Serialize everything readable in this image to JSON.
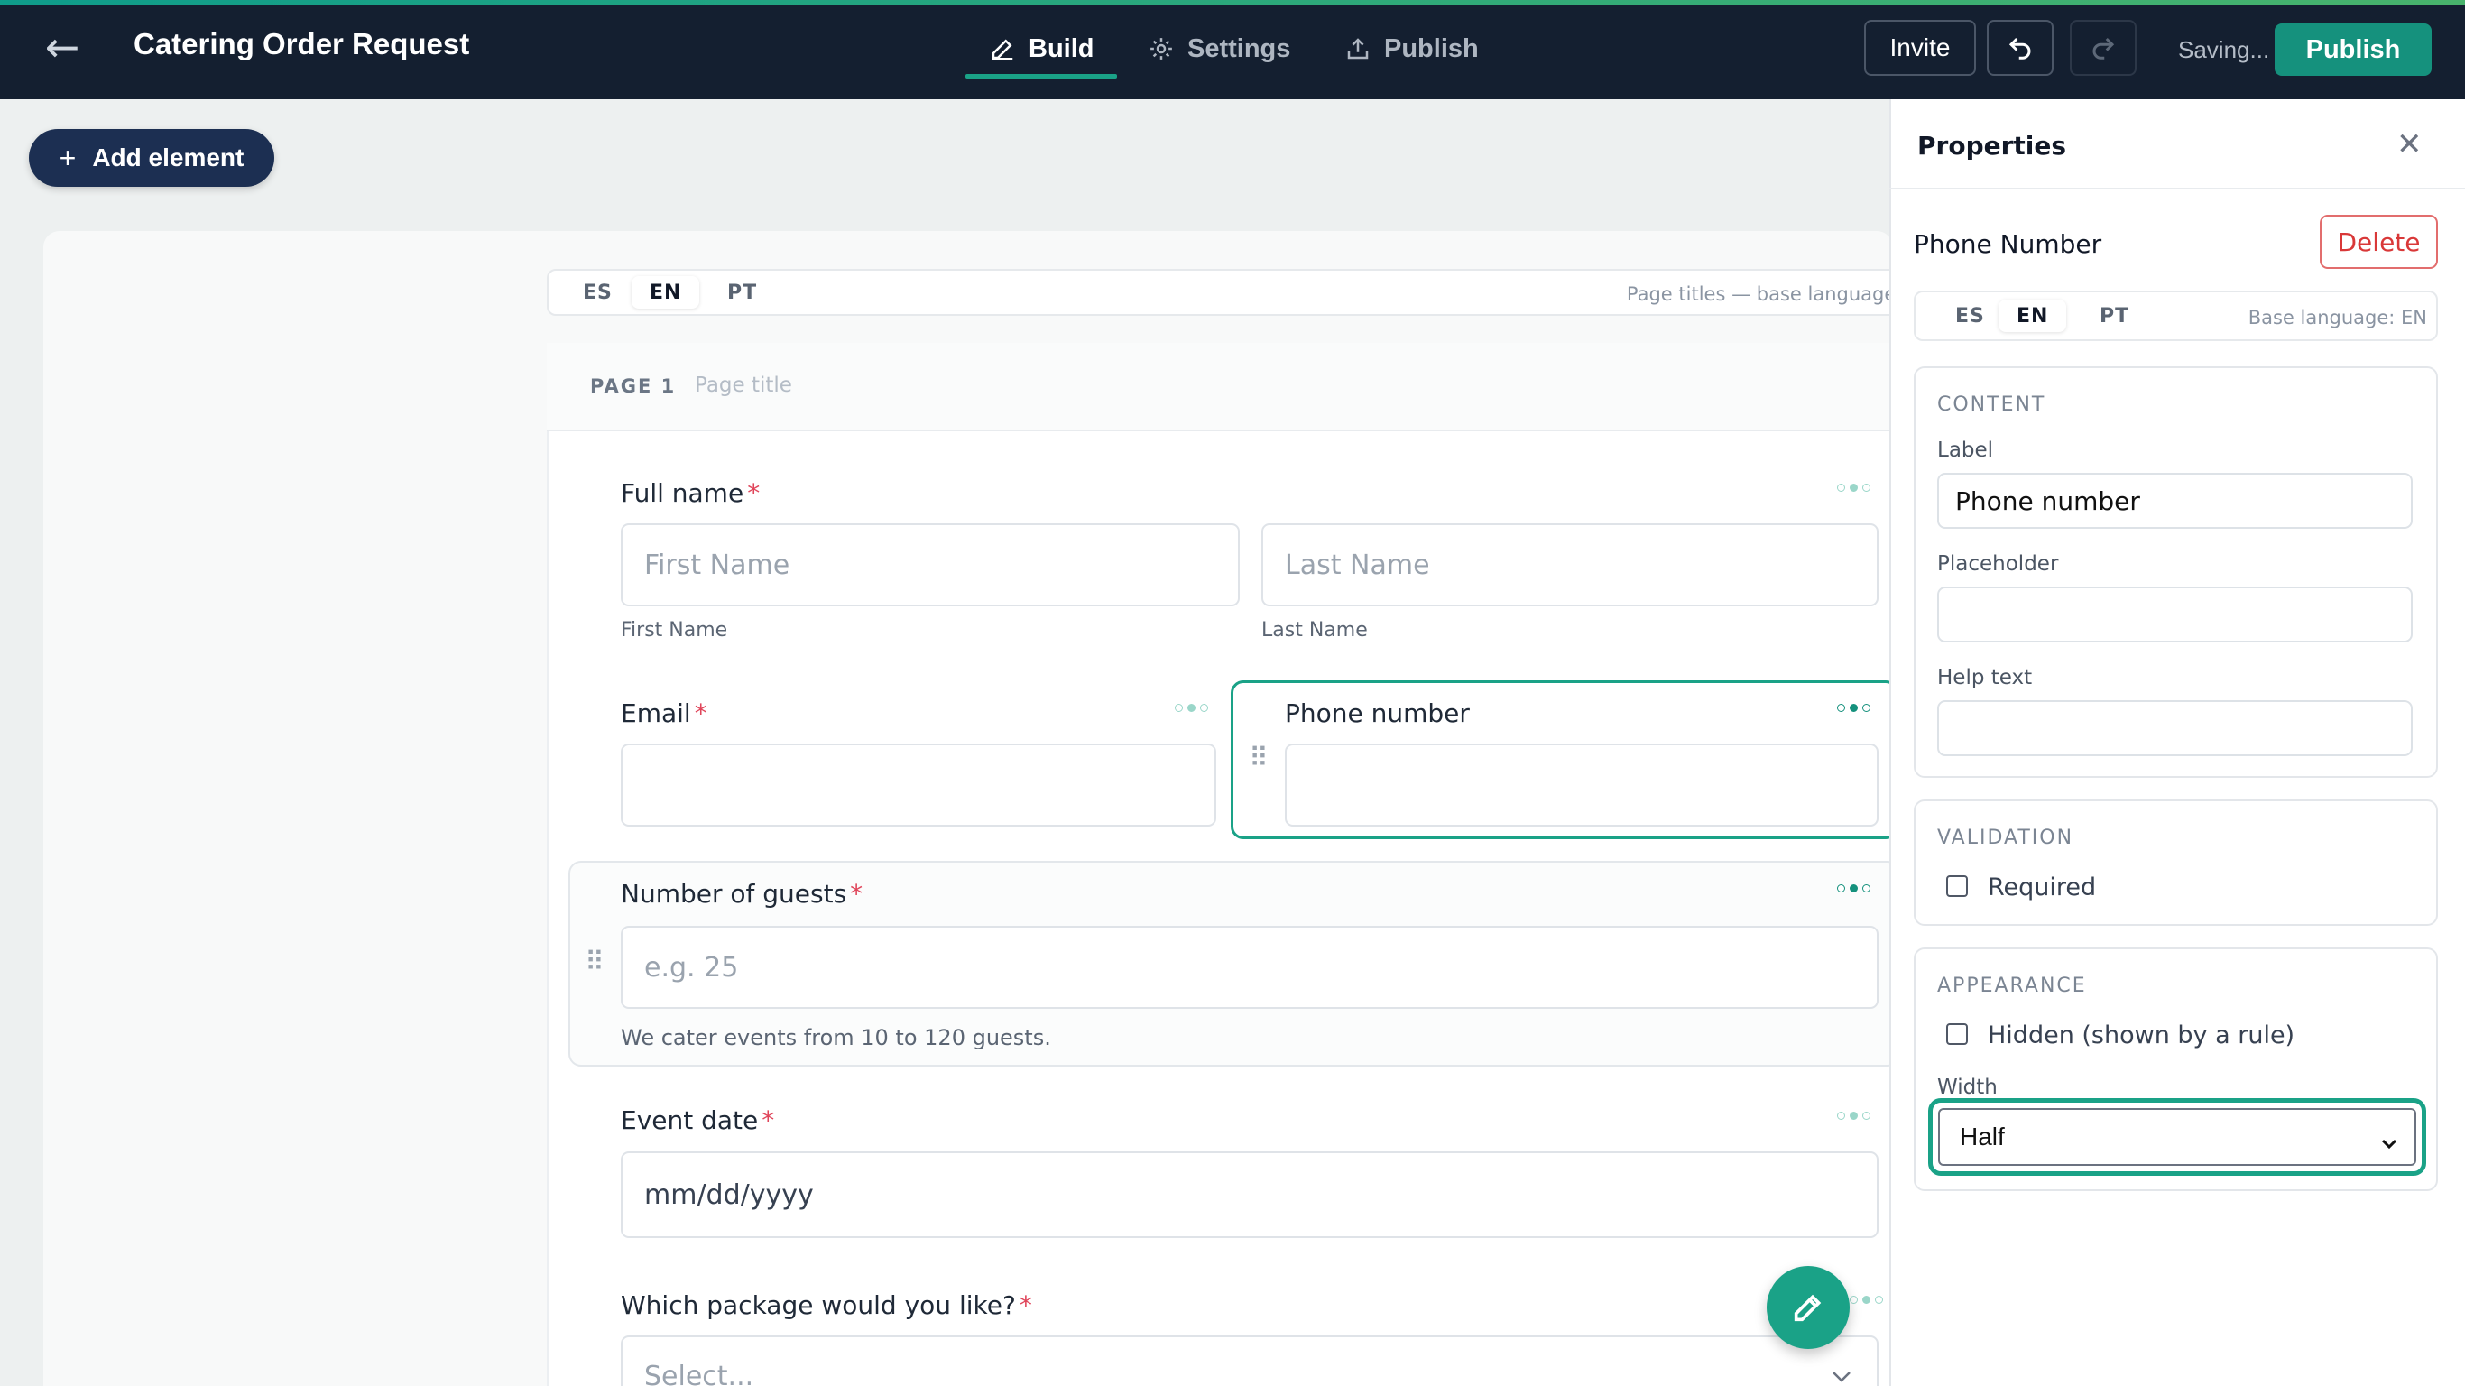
{
  "header": {
    "back_icon": "arrow-left-icon",
    "title": "Catering Order Request",
    "tabs": [
      {
        "label": "Build",
        "icon": "pencil-icon",
        "active": true
      },
      {
        "label": "Settings",
        "icon": "gear-icon",
        "active": false
      },
      {
        "label": "Publish",
        "icon": "upload-icon",
        "active": false
      }
    ],
    "invite_label": "Invite",
    "undo_icon": "undo-icon",
    "redo_icon": "redo-icon",
    "status": "Saving...",
    "publish_label": "Publish",
    "accent_color": "#1aa287",
    "bar_color": "#141f30"
  },
  "toolbar": {
    "add_element_label": "Add element",
    "add_icon": "plus-icon"
  },
  "canvas": {
    "languages": [
      "ES",
      "EN",
      "PT"
    ],
    "active_language": "EN",
    "language_note": "Page titles — base language: EN",
    "page": {
      "label": "PAGE 1",
      "title_placeholder": "Page title"
    },
    "fields": {
      "full_name": {
        "label": "Full name",
        "required": "*",
        "first_placeholder": "First Name",
        "last_placeholder": "Last Name",
        "first_sublabel": "First Name",
        "last_sublabel": "Last Name"
      },
      "email": {
        "label": "Email",
        "required": "*"
      },
      "phone": {
        "label": "Phone number"
      },
      "guests": {
        "label": "Number of guests",
        "required": "*",
        "placeholder": "e.g. 25",
        "help": "We cater events from 10 to 120 guests."
      },
      "event_date": {
        "label": "Event date",
        "required": "*",
        "placeholder": "mm/dd/yyyy"
      },
      "package": {
        "label": "Which package would you like?",
        "required": "*",
        "placeholder": "Select..."
      }
    }
  },
  "panel": {
    "title": "Properties",
    "close_icon": "close-icon",
    "field_name": "Phone Number",
    "delete_label": "Delete",
    "languages": [
      "ES",
      "EN",
      "PT"
    ],
    "active_language": "EN",
    "base_language_note": "Base language: EN",
    "content": {
      "title": "CONTENT",
      "label_label": "Label",
      "label_value": "Phone number",
      "placeholder_label": "Placeholder",
      "placeholder_value": "",
      "help_label": "Help text",
      "help_value": ""
    },
    "validation": {
      "title": "VALIDATION",
      "required_label": "Required",
      "required_checked": false
    },
    "appearance": {
      "title": "APPEARANCE",
      "hidden_label": "Hidden (shown by a rule)",
      "hidden_checked": false,
      "width_label": "Width",
      "width_value": "Half"
    }
  }
}
